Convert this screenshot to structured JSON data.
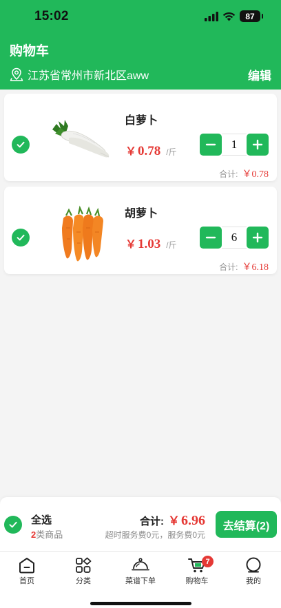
{
  "status_bar": {
    "time": "15:02",
    "battery": "87"
  },
  "header": {
    "title": "购物车",
    "address": "江苏省常州市新北区aww",
    "edit_label": "编辑"
  },
  "cart": {
    "items": [
      {
        "name": "白萝卜",
        "currency": "￥",
        "price": "0.78",
        "unit": "/斤",
        "quantity": "1",
        "subtotal_label": "合计:",
        "subtotal": "￥0.78",
        "icon": "white-radish-image",
        "checked": true
      },
      {
        "name": "胡萝卜",
        "currency": "￥",
        "price": "1.03",
        "unit": "/斤",
        "quantity": "6",
        "subtotal_label": "合计:",
        "subtotal": "￥6.18",
        "icon": "carrot-image",
        "checked": true
      }
    ]
  },
  "checkout": {
    "select_all_label": "全选",
    "category_count": "2",
    "category_suffix": "类商品",
    "total_label": "合计:",
    "currency": "￥",
    "total": "6.96",
    "service_fee_note": "超时服务费0元，服务费0元",
    "button_label": "去结算(2)"
  },
  "tabs": [
    {
      "label": "首页",
      "icon": "home-icon"
    },
    {
      "label": "分类",
      "icon": "category-icon"
    },
    {
      "label": "菜谱下单",
      "icon": "cloche-icon"
    },
    {
      "label": "购物车",
      "icon": "cart-icon",
      "badge": "7",
      "active": true
    },
    {
      "label": "我的",
      "icon": "profile-icon"
    }
  ],
  "colors": {
    "brand": "#21b85a",
    "price": "#e53935"
  }
}
